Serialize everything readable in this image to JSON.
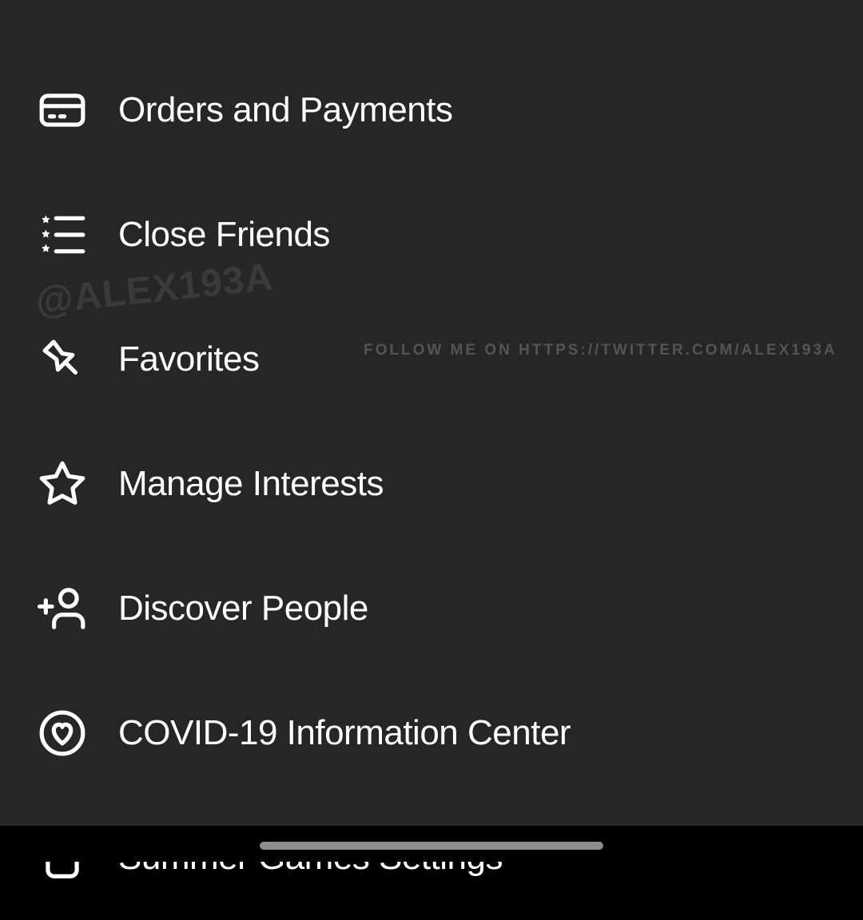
{
  "watermarks": {
    "handle": "@ALEX193A",
    "follow": "FOLLOW ME ON HTTPS://TWITTER.COM/ALEX193A"
  },
  "menu": {
    "items": [
      {
        "label": "Orders and Payments",
        "icon": "credit-card-icon"
      },
      {
        "label": "Close Friends",
        "icon": "star-list-icon"
      },
      {
        "label": "Favorites",
        "icon": "pushpin-icon"
      },
      {
        "label": "Manage Interests",
        "icon": "star-outline-icon"
      },
      {
        "label": "Discover People",
        "icon": "add-person-icon"
      },
      {
        "label": "COVID-19 Information Center",
        "icon": "heart-circle-icon"
      },
      {
        "label": "Summer Games Settings",
        "icon": "lock-icon"
      }
    ]
  }
}
